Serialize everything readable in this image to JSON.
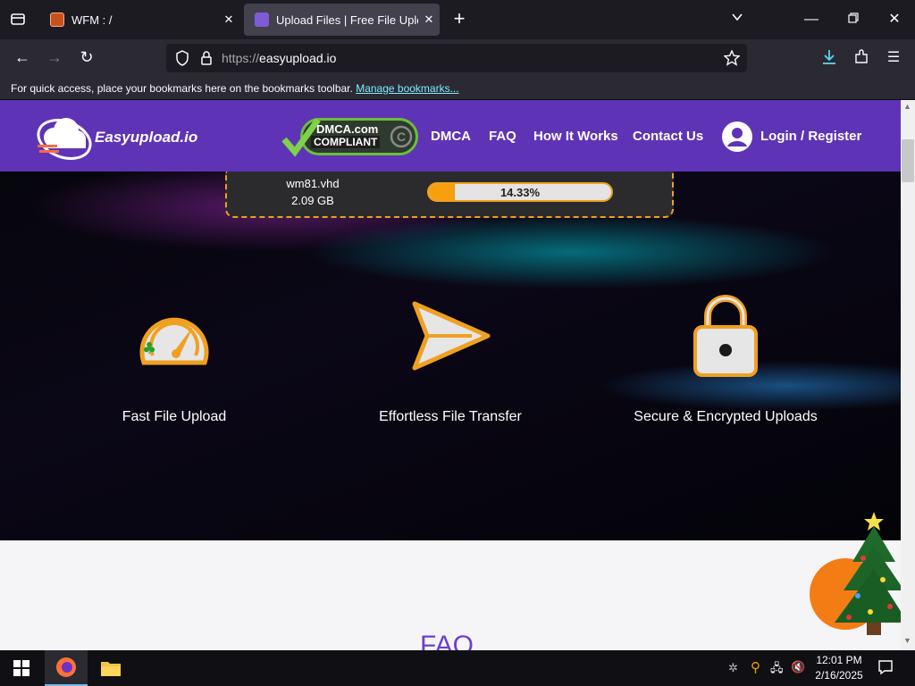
{
  "browser": {
    "tabs": [
      {
        "title": "WFM : /",
        "active": false
      },
      {
        "title": "Upload Files | Free File Upload and...",
        "active": true
      }
    ],
    "url": {
      "scheme": "https://",
      "host": "easyupload.io"
    },
    "bookmarks_bar": {
      "message": "For quick access, place your bookmarks here on the bookmarks toolbar.",
      "link": "Manage bookmarks..."
    }
  },
  "site": {
    "logo": "Easyupload.io",
    "dmca_badge": {
      "line1": "DMCA.com",
      "line2": "COMPLIANT"
    },
    "nav": [
      "DMCA",
      "FAQ",
      "How It Works",
      "Contact Us",
      "Login / Register"
    ],
    "upload": {
      "filename": "wm81.vhd",
      "size": "2.09 GB",
      "progress_label": "14.33%",
      "progress": 0.1433
    },
    "features": [
      {
        "label": "Fast File Upload",
        "icon": "speedometer-icon"
      },
      {
        "label": "Effortless File Transfer",
        "icon": "paper-plane-icon"
      },
      {
        "label": "Secure & Encrypted Uploads",
        "icon": "padlock-icon"
      }
    ],
    "faq_heading": "FAQ"
  },
  "taskbar": {
    "time": "12:01 PM",
    "date": "2/16/2025"
  },
  "colors": {
    "brand": "#5f33b5",
    "accent": "#f5a00c"
  }
}
